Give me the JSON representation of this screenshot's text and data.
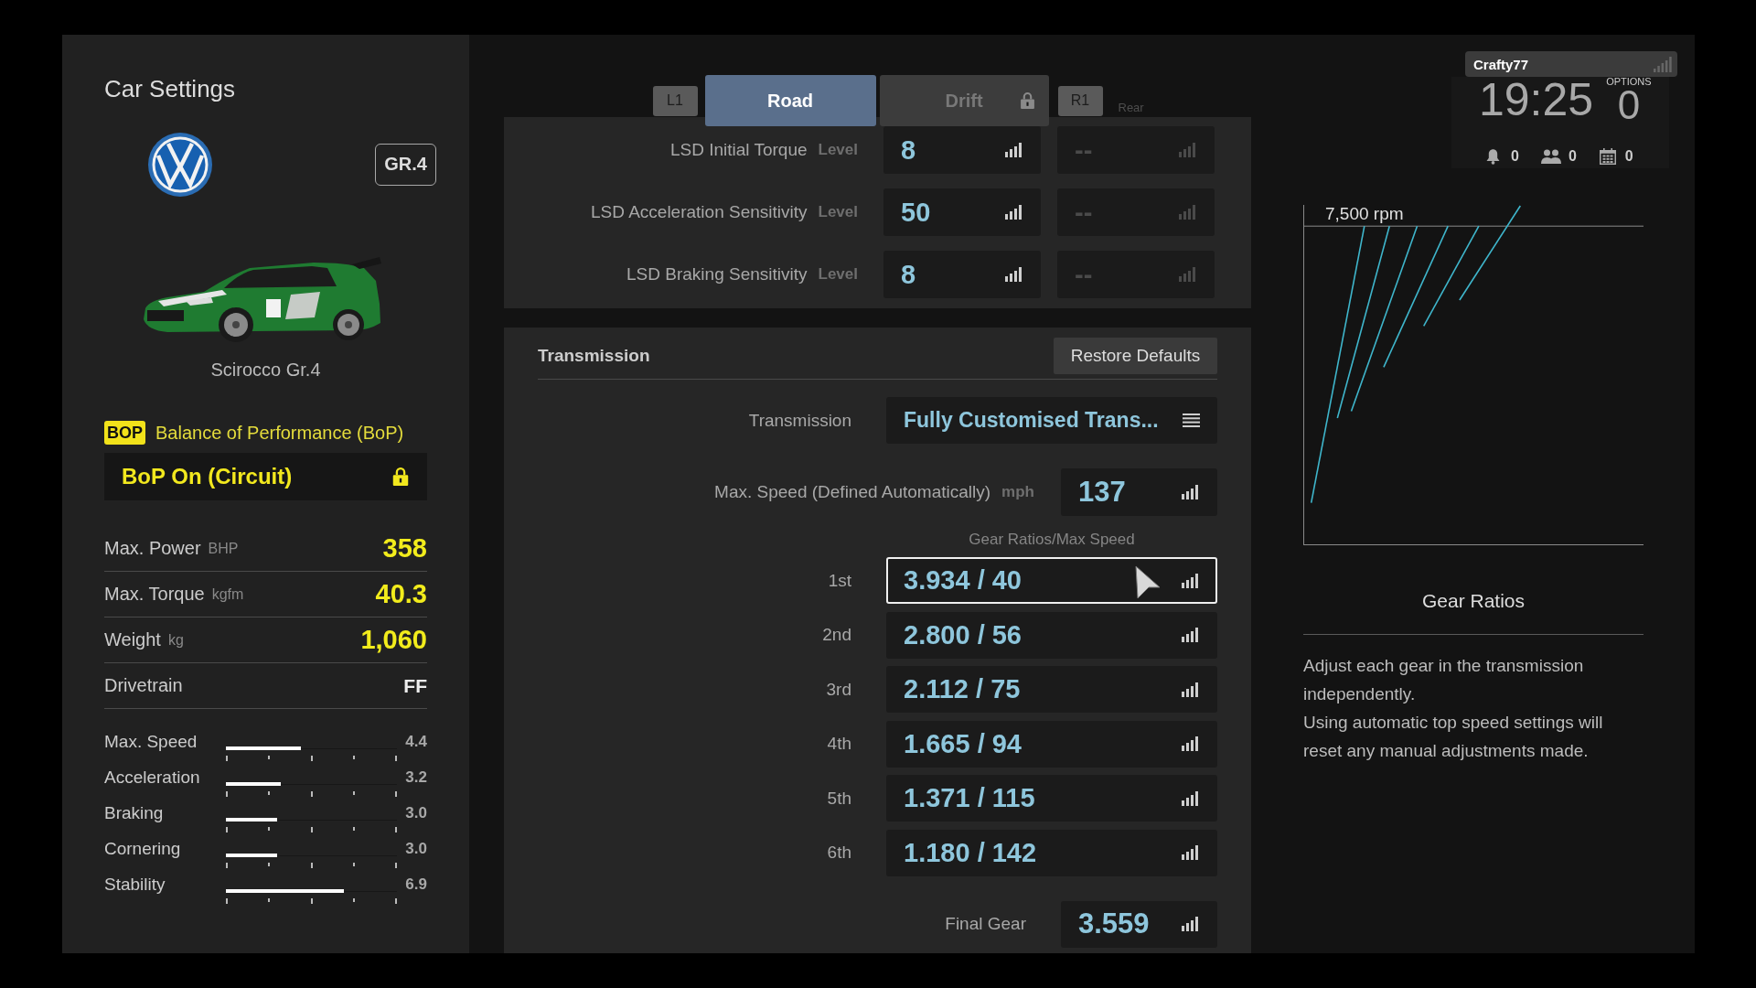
{
  "left_panel": {
    "title": "Car Settings",
    "class_badge": "GR.4",
    "car_name": "Scirocco Gr.4",
    "bop": {
      "badge": "BOP",
      "title": "Balance of Performance (BoP)",
      "value": "BoP On (Circuit)",
      "locked": true
    },
    "specs": [
      {
        "label": "Max. Power",
        "unit": "BHP",
        "value": "358",
        "highlighted": true
      },
      {
        "label": "Max. Torque",
        "unit": "kgfm",
        "value": "40.3",
        "highlighted": true
      },
      {
        "label": "Weight",
        "unit": "kg",
        "value": "1,060",
        "highlighted": true
      },
      {
        "label": "Drivetrain",
        "value": "FF",
        "highlighted": false
      }
    ],
    "ratings": [
      {
        "label": "Max. Speed",
        "level": 0.44,
        "reading": "4.4"
      },
      {
        "label": "Acceleration",
        "level": 0.32,
        "reading": "3.2"
      },
      {
        "label": "Braking",
        "level": 0.3,
        "reading": "3.0"
      },
      {
        "label": "Cornering",
        "level": 0.3,
        "reading": "3.0"
      },
      {
        "label": "Stability",
        "level": 0.69,
        "reading": "6.9"
      }
    ]
  },
  "mode_tabs": {
    "prev_key": "L1",
    "next_key": "R1",
    "items": [
      {
        "label": "Road",
        "selected": true,
        "locked": false
      },
      {
        "label": "Drift",
        "selected": false,
        "locked": true
      }
    ]
  },
  "lsd": {
    "column_header": "Rear",
    "rows": [
      {
        "label": "LSD Initial Torque",
        "unit": "Level",
        "front": {
          "value": "8",
          "disabled": false
        },
        "rear": {
          "value": "--",
          "disabled": true
        }
      },
      {
        "label": "LSD Acceleration Sensitivity",
        "unit": "Level",
        "front": {
          "value": "50",
          "disabled": false
        },
        "rear": {
          "value": "--",
          "disabled": true
        }
      },
      {
        "label": "LSD Braking Sensitivity",
        "unit": "Level",
        "front": {
          "value": "8",
          "disabled": false
        },
        "rear": {
          "value": "--",
          "disabled": true
        }
      }
    ]
  },
  "transmission": {
    "title": "Transmission",
    "restore_button": "Restore Defaults",
    "type": {
      "label": "Transmission",
      "value": "Fully Customised Trans..."
    },
    "max_speed": {
      "label": "Max. Speed (Defined Automatically)",
      "unit": "mph",
      "value": "137"
    },
    "gears_header": "Gear Ratios/Max Speed",
    "gears": [
      {
        "label": "1st",
        "value": "3.934 / 40",
        "selected": true
      },
      {
        "label": "2nd",
        "value": "2.800 / 56",
        "selected": false
      },
      {
        "label": "3rd",
        "value": "2.112 / 75",
        "selected": false
      },
      {
        "label": "4th",
        "value": "1.665 / 94",
        "selected": false
      },
      {
        "label": "5th",
        "value": "1.371 / 115",
        "selected": false
      },
      {
        "label": "6th",
        "value": "1.180 / 142",
        "selected": false
      }
    ],
    "final_gear": {
      "label": "Final Gear",
      "value": "3.559"
    }
  },
  "system_overlay": {
    "user": "Crafty77",
    "time": "19:25",
    "options_label": "OPTIONS",
    "options_count": "0",
    "notifications": "0",
    "friends": "0",
    "events": "0"
  },
  "help_panel": {
    "chart_label": "7,500 rpm",
    "title": "Gear Ratios",
    "paragraphs": [
      "Adjust each gear in the transmission independently.",
      "Using automatic top speed settings will reset any manual adjustments made."
    ]
  }
}
